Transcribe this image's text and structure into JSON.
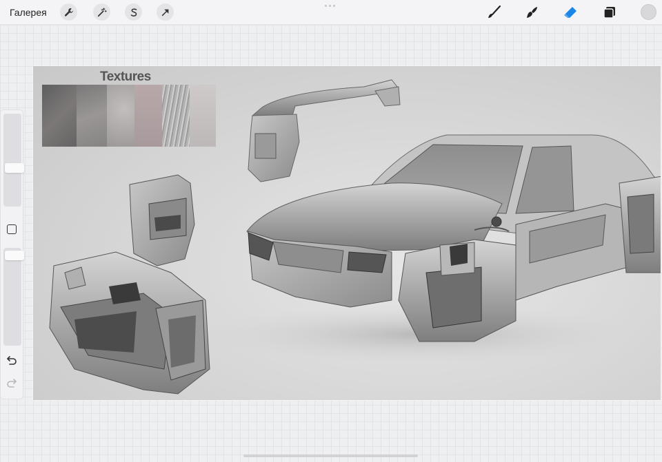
{
  "topbar": {
    "gallery_label": "Галерея",
    "left_tools": [
      "wrench-icon",
      "magic-wand-icon",
      "selection-s-icon",
      "transform-arrow-icon"
    ],
    "right_tools": [
      "brush-icon",
      "smudge-icon",
      "eraser-icon",
      "layers-icon",
      "color-picker-icon"
    ]
  },
  "canvas": {
    "textures_title": "Textures",
    "texture_swatch_colors": [
      "#6e6e6e",
      "#8a8888",
      "#a29e9e",
      "#b7aaaa",
      "#bcbcbc",
      "#c8c6c6"
    ]
  },
  "colors": {
    "eraser_active": "#1a86e8",
    "active_color": "#d8d8da"
  }
}
